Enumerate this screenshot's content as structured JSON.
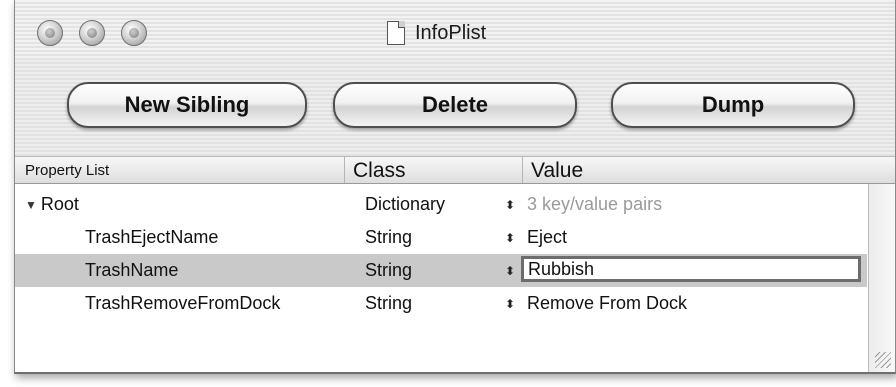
{
  "window": {
    "title": "InfoPlist",
    "title_icon": "document-icon"
  },
  "toolbar": {
    "new_sibling_label": "New Sibling",
    "delete_label": "Delete",
    "dump_label": "Dump"
  },
  "table": {
    "headers": {
      "property": "Property List",
      "class": "Class",
      "value": "Value"
    },
    "rows": [
      {
        "key": "Root",
        "class": "Dictionary",
        "value": "3 key/value pairs",
        "expanded": true
      },
      {
        "key": "TrashEjectName",
        "class": "String",
        "value": "Eject"
      },
      {
        "key": "TrashName",
        "class": "String",
        "value": "Rubbish",
        "selected": true,
        "editing": true
      },
      {
        "key": "TrashRemoveFromDock",
        "class": "String",
        "value": "Remove From Dock"
      }
    ]
  },
  "icons": {
    "disclosure": "▼",
    "stepper": "⬍"
  },
  "colors": {
    "selection": "#c9c9c9",
    "muted_text": "#9a9a9a"
  }
}
